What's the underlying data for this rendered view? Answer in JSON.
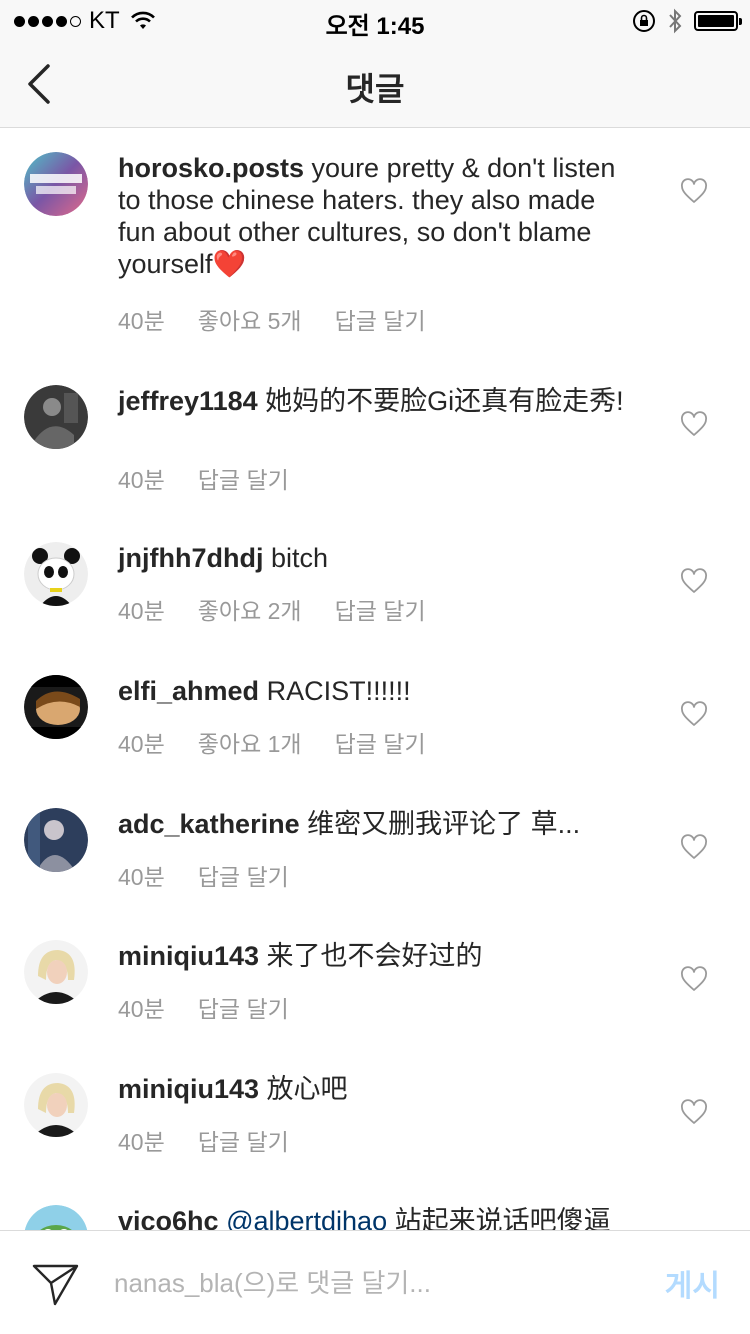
{
  "status_bar": {
    "carrier": "KT",
    "time": "오전 1:45"
  },
  "nav": {
    "title": "댓글"
  },
  "comments": [
    {
      "username": "horosko.posts",
      "text": " youre pretty & don't listen to those chinese haters. they also made fun about other cultures, so don't blame yourself",
      "emoji": "❤️",
      "time": "40분",
      "likes": "좋아요 5개",
      "reply": "답글 달기"
    },
    {
      "username": "jeffrey1184",
      "text": " 她妈的不要脸Gi还真有脸走秀!",
      "time": "40분",
      "reply": "답글 달기"
    },
    {
      "username": "jnjfhh7dhdj",
      "text": " bitch",
      "time": "40분",
      "likes": "좋아요 2개",
      "reply": "답글 달기"
    },
    {
      "username": "elfi_ahmed",
      "text": " RACIST!!!!!!",
      "time": "40분",
      "likes": "좋아요 1개",
      "reply": "답글 달기"
    },
    {
      "username": "adc_katherine",
      "text": " 维密又删我评论了 草...",
      "time": "40분",
      "reply": "답글 달기"
    },
    {
      "username": "miniqiu143",
      "text": " 来了也不会好过的",
      "time": "40분",
      "reply": "답글 달기"
    },
    {
      "username": "miniqiu143",
      "text": " 放心吧",
      "time": "40분",
      "reply": "답글 달기"
    },
    {
      "username": "vico6hc",
      "mention": "@albertdihao",
      "text": " 站起来说话吧傻逼"
    }
  ],
  "footer": {
    "placeholder": "nanas_bla(으)로 댓글 달기...",
    "post_label": "게시"
  },
  "colors": {
    "accent_disabled": "#b3dbff",
    "meta_gray": "#999999",
    "mention": "#003569"
  }
}
